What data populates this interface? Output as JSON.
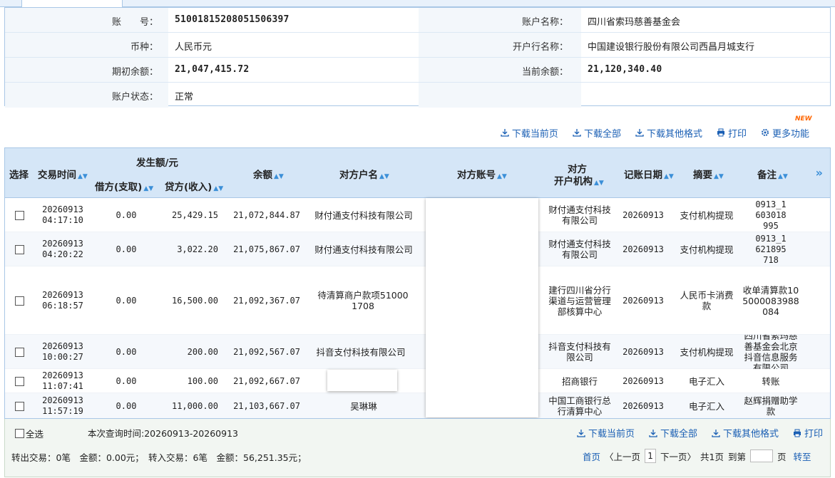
{
  "account": {
    "rows": [
      {
        "left_label": "账　　号：",
        "left_value": "51001815208051506397",
        "right_label": "账户名称：",
        "right_value": "四川省索玛慈善基金会"
      },
      {
        "left_label": "币种：",
        "left_value": "人民币元",
        "right_label": "开户行名称：",
        "right_value": "中国建设银行股份有限公司西昌月城支行"
      },
      {
        "left_label": "期初余额：",
        "left_value": "21,047,415.72",
        "right_label": "当前余额：",
        "right_value": "21,120,340.40"
      },
      {
        "left_label": "账户状态：",
        "left_value": "正常",
        "right_label": "",
        "right_value": ""
      }
    ]
  },
  "toolbar": {
    "download_page": "下载当前页",
    "download_all": "下载全部",
    "download_other": "下载其他格式",
    "print": "打印",
    "more": "更多功能",
    "new_badge": "NEW"
  },
  "table": {
    "headers": {
      "select": "选择",
      "time": "交易时间",
      "amount_group": "发生额/元",
      "debit": "借方(支取)",
      "credit": "贷方(收入)",
      "balance": "余额",
      "counter_name": "对方户名",
      "counter_account": "对方账号",
      "counter_bank_1": "对方",
      "counter_bank_2": "开户机构",
      "post_date": "记账日期",
      "summary": "摘要",
      "remark": "备注",
      "expand": "»"
    },
    "rows": [
      {
        "date": "20260913",
        "time": "04:17:10",
        "debit": "0.00",
        "credit": "25,429.15",
        "balance": "21,072,844.87",
        "counter_name": "财付通支付科技有限公司",
        "counter_bank": "财付通支付科技有限公司",
        "post_date": "20260913",
        "summary": "支付机构提现",
        "remark": "0913_1603018995"
      },
      {
        "date": "20260913",
        "time": "04:20:22",
        "debit": "0.00",
        "credit": "3,022.20",
        "balance": "21,075,867.07",
        "counter_name": "财付通支付科技有限公司",
        "counter_bank": "财付通支付科技有限公司",
        "post_date": "20260913",
        "summary": "支付机构提现",
        "remark": "0913_1621895718"
      },
      {
        "date": "20260913",
        "time": "06:18:57",
        "debit": "0.00",
        "credit": "16,500.00",
        "balance": "21,092,367.07",
        "counter_name": "待清算商户款项510001708",
        "counter_bank": "建行四川省分行渠道与运营管理部核算中心",
        "post_date": "20260913",
        "summary": "人民币卡消费款",
        "remark": "收单清算款105000083988084"
      },
      {
        "date": "20260913",
        "time": "10:00:27",
        "debit": "0.00",
        "credit": "200.00",
        "balance": "21,092,567.07",
        "counter_name": "抖音支付科技有限公司",
        "counter_bank": "抖音支付科技有限公司",
        "post_date": "20260913",
        "summary": "支付机构提现",
        "remark": "四川省索玛慈善基金会北京抖音信息服务有限公司"
      },
      {
        "date": "20260913",
        "time": "11:07:41",
        "debit": "0.00",
        "credit": "100.00",
        "balance": "21,092,667.07",
        "counter_name": "",
        "counter_bank": "招商银行",
        "post_date": "20260913",
        "summary": "电子汇入",
        "remark": "转账"
      },
      {
        "date": "20260913",
        "time": "11:57:19",
        "debit": "0.00",
        "credit": "11,000.00",
        "balance": "21,103,667.07",
        "counter_name": "吴琳琳",
        "counter_bank": "中国工商银行总行清算中心",
        "post_date": "20260913",
        "summary": "电子汇入",
        "remark": "赵辉捐赠助学款"
      }
    ]
  },
  "footer": {
    "select_all": "全选",
    "query_time": "本次查询时间:20260913-20260913",
    "download_page": "下载当前页",
    "download_all": "下载全部",
    "download_other": "下载其他格式",
    "print": "打印",
    "summary_text": "转出交易：0笔　金额：0.00元；　转入交易：6笔　金额：56,251.35元；",
    "first_page": "首页",
    "prev_page": "〈上一页",
    "current_page": "1",
    "next_page": "下一页〉",
    "total_pages": "共1页",
    "goto_label": "到第",
    "page_unit": "页",
    "goto_button": "转至"
  }
}
